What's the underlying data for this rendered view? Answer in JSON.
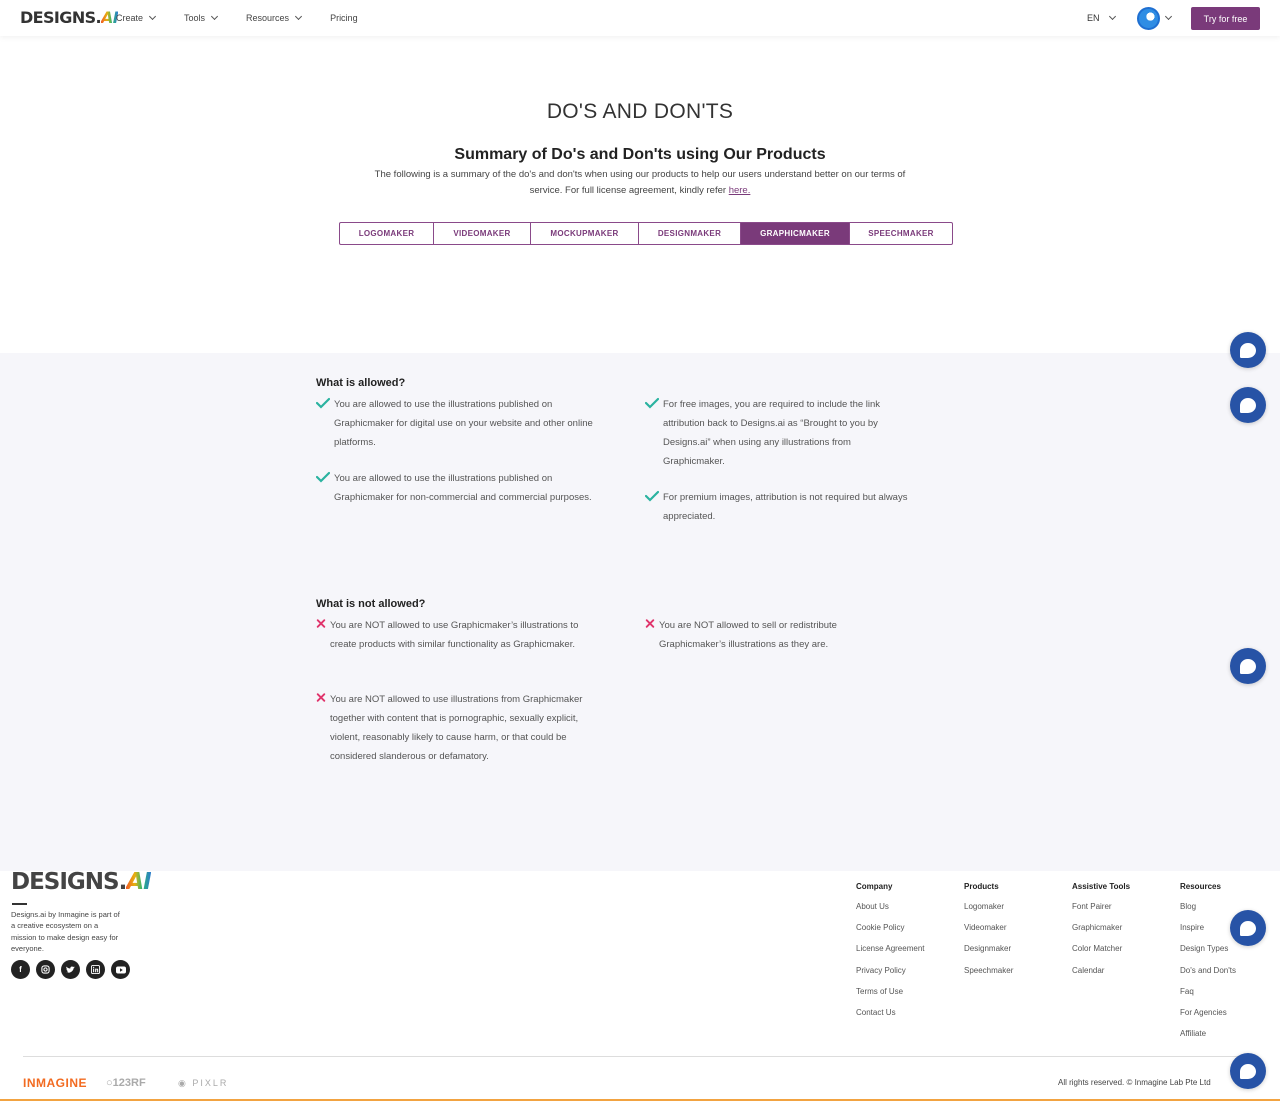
{
  "nav": {
    "logo_text": "DESIGNS.",
    "logo_ai": "AI",
    "menu": [
      {
        "label": "Create",
        "dropdown": true
      },
      {
        "label": "Tools",
        "dropdown": true
      },
      {
        "label": "Resources",
        "dropdown": true
      },
      {
        "label": "Pricing",
        "dropdown": false
      }
    ],
    "language": "EN",
    "try_label": "Try for free"
  },
  "hero": {
    "title": "DO'S AND DON'TS",
    "subtitle": "Summary of Do's and Don'ts using Our Products",
    "intro": "The following is a summary of the do's and don'ts when using our products to help our users understand better on our terms of service. For full license agreement, kindly refer ",
    "intro_link": "here."
  },
  "tabs": [
    {
      "label": "LOGOMAKER",
      "active": false
    },
    {
      "label": "VIDEOMAKER",
      "active": false
    },
    {
      "label": "MOCKUPMAKER",
      "active": false
    },
    {
      "label": "DESIGNMAKER",
      "active": false
    },
    {
      "label": "GRAPHICMAKER",
      "active": true
    },
    {
      "label": "SPEECHMAKER",
      "active": false
    }
  ],
  "allowed": {
    "title": "What is allowed?",
    "items": [
      "You are allowed to use the illustrations published on Graphicmaker for digital use on your website and other online platforms.",
      "You are allowed to use the illustrations published on Graphicmaker for non-commercial and commercial purposes.",
      "For free images, you are required to include the link attribution back to Designs.ai as “Brought to you by Designs.ai” when using any illustrations from Graphicmaker.",
      "For premium images, attribution is not required but always appreciated."
    ]
  },
  "not_allowed": {
    "title": "What is not allowed?",
    "items": [
      "You are NOT allowed to use Graphicmaker’s illustrations to create products with similar functionality as Graphicmaker.",
      "You are NOT allowed to use illustrations from Graphicmaker together with content that is pornographic, sexually explicit, violent, reasonably likely to cause harm, or that could be considered slanderous or defamatory.",
      "You are NOT allowed to sell or redistribute Graphicmaker’s illustrations as they are."
    ]
  },
  "colors": {
    "brand": "#7a3a7a",
    "check": "#2bb3a0",
    "cross": "#e0336b",
    "chat": "#2753a6"
  },
  "footer": {
    "logo_text": "DESIGNS.",
    "logo_ai": "AI",
    "description": "Designs.ai by Inmagine is part of a creative ecosystem on a mission to make design easy for everyone.",
    "socials": [
      "facebook-icon",
      "instagram-icon",
      "twitter-icon",
      "linkedin-icon",
      "youtube-icon"
    ],
    "columns": [
      {
        "heading": "Company",
        "links": [
          "About Us",
          "Cookie Policy",
          "License Agreement",
          "Privacy Policy",
          "Terms of Use",
          "Contact Us"
        ]
      },
      {
        "heading": "Products",
        "links": [
          "Logomaker",
          "Videomaker",
          "Designmaker",
          "Speechmaker"
        ]
      },
      {
        "heading": "Assistive Tools",
        "links": [
          "Font Pairer",
          "Graphicmaker",
          "Color Matcher",
          "Calendar"
        ]
      },
      {
        "heading": "Resources",
        "links": [
          "Blog",
          "Inspire",
          "Design Types",
          "Do's and Don'ts",
          "Faq",
          "For Agencies",
          "Affiliate"
        ]
      }
    ],
    "brands": [
      "INMAGINE",
      "123RF",
      "PIXLR"
    ],
    "copyright": "All rights reserved. © Inmagine Lab Pte Ltd"
  }
}
